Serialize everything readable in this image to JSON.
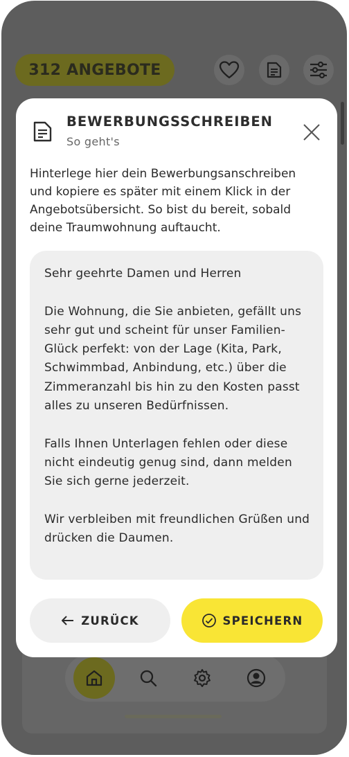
{
  "header": {
    "offer_count_label": "312 ANGEBOTE",
    "icons": [
      "heart-icon",
      "document-icon",
      "sliders-icon"
    ]
  },
  "nav": {
    "items": [
      {
        "icon": "home-icon",
        "active": true
      },
      {
        "icon": "search-icon",
        "active": false
      },
      {
        "icon": "gear-icon",
        "active": false
      },
      {
        "icon": "user-icon",
        "active": false
      }
    ]
  },
  "modal": {
    "title": "BEWERBUNGSSCHREIBEN",
    "subtitle": "So geht's",
    "intro": "Hinterlege hier dein Bewerbungsanschreiben und kopiere es später mit einem Klick in der Angebotsübersicht. So bist du bereit, sobald deine Traumwohnung auftaucht.",
    "letter": {
      "salutation": "Sehr geehrte Damen und Herren",
      "paragraph1": "Die Wohnung, die Sie anbieten, gefällt uns sehr gut und scheint für unser Familien-Glück perfekt: von der Lage (Kita, Park, Schwimmbad, Anbindung, etc.) über die Zimmeranzahl bis hin zu den Kosten passt alles zu unseren Bedürfnissen.",
      "paragraph2": "Falls Ihnen Unterlagen fehlen oder diese nicht eindeutig genug sind, dann melden Sie sich gerne jederzeit.",
      "closing": "Wir verbleiben mit freundlichen Grüßen und drücken die Daumen."
    },
    "back_label": "ZURÜCK",
    "save_label": "SPEICHERN"
  },
  "colors": {
    "accent": "#f9e535",
    "overlay": "#5d5d5d",
    "letter_bg": "#efefef"
  }
}
